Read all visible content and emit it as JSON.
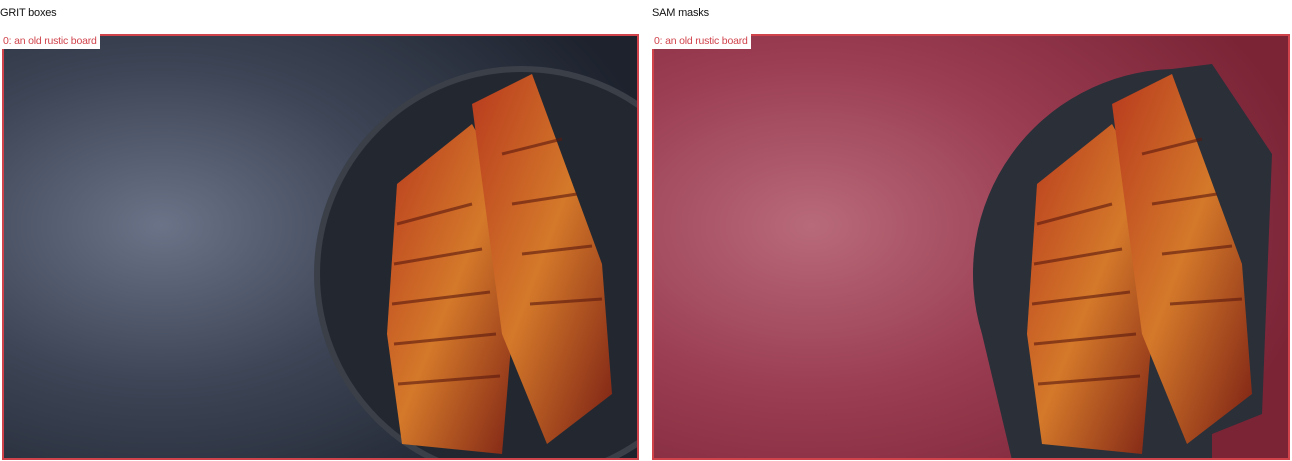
{
  "panels": [
    {
      "title": "GRIT boxes",
      "detection_label": "0: an old rustic board",
      "mode": "box"
    },
    {
      "title": "SAM masks",
      "detection_label": "0: an old rustic board",
      "mode": "mask"
    }
  ],
  "colors": {
    "box_outline": "#d0434b",
    "label_text": "#d0434b",
    "mask_overlay": "#b8324a"
  }
}
